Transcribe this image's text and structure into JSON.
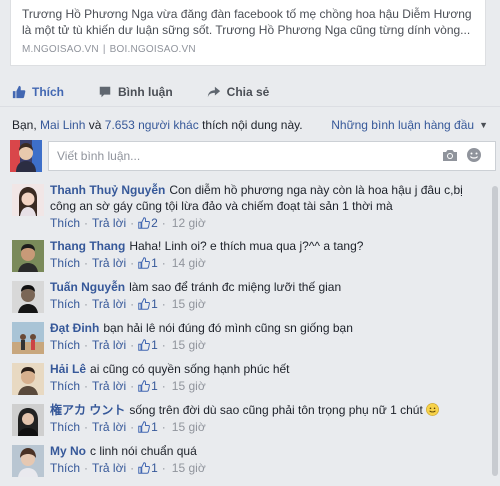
{
  "link_preview": {
    "description": "Trương Hồ Phương Nga vừa đăng đàn facebook tố mẹ chồng hoa hậu Diễm Hương là một tử tù khiến dư luận sững sốt. Trương Hồ Phương Nga cũng từng dính vòng...",
    "source_1": "M.NGOISAO.VN",
    "separator": "|",
    "source_2": "BOI.NGOISAO.VN"
  },
  "actions": {
    "like_label": "Thích",
    "comment_label": "Bình luận",
    "share_label": "Chia sẻ"
  },
  "likes_summary": {
    "prefix": "Bạn,",
    "friend": "Mai Linh",
    "and": "và",
    "others": "7.653 người khác",
    "suffix": "thích nội dung này.",
    "sort_label": "Những bình luận hàng đầu"
  },
  "composer": {
    "placeholder": "Viết bình luận..."
  },
  "comment_meta": {
    "like_label": "Thích",
    "reply_label": "Trả lời",
    "dot": "·"
  },
  "comments": [
    {
      "author": "Thanh Thuỷ Nguyễn",
      "text": "Con diễm hồ phương nga này còn là hoa hậu j đâu c,bị công an sờ gáy cũng tội lừa đảo và chiếm đoạt tài sản 1 thời mà",
      "likes": "2",
      "time": "12 giờ"
    },
    {
      "author": "Thang Thang",
      "text": "Haha! Linh oi? e thích mua qua j?^^ a tang?",
      "likes": "1",
      "time": "14 giờ"
    },
    {
      "author": "Tuấn Nguyễn",
      "text": "làm sao để tránh đc miệng lưỡi thế gian",
      "likes": "1",
      "time": "15 giờ"
    },
    {
      "author": "Đạt Đinh",
      "text": "bạn hải lê nói đúng đó mình cũng sn giống bạn",
      "likes": "1",
      "time": "15 giờ"
    },
    {
      "author": "Hải Lê",
      "text": "ai cũng có quyền sống hạnh phúc hết",
      "likes": "1",
      "time": "15 giờ"
    },
    {
      "author": "権アカ ウント",
      "text": "sống trên đời dù sao cũng phải tôn trọng phụ nữ 1 chút",
      "likes": "1",
      "time": "15 giờ"
    },
    {
      "author": "My No",
      "text": "c linh nói chuẩn quá",
      "likes": "1",
      "time": "15 giờ"
    }
  ],
  "colors": {
    "link": "#365899",
    "accent": "#4267b2",
    "meta": "#90949c"
  }
}
